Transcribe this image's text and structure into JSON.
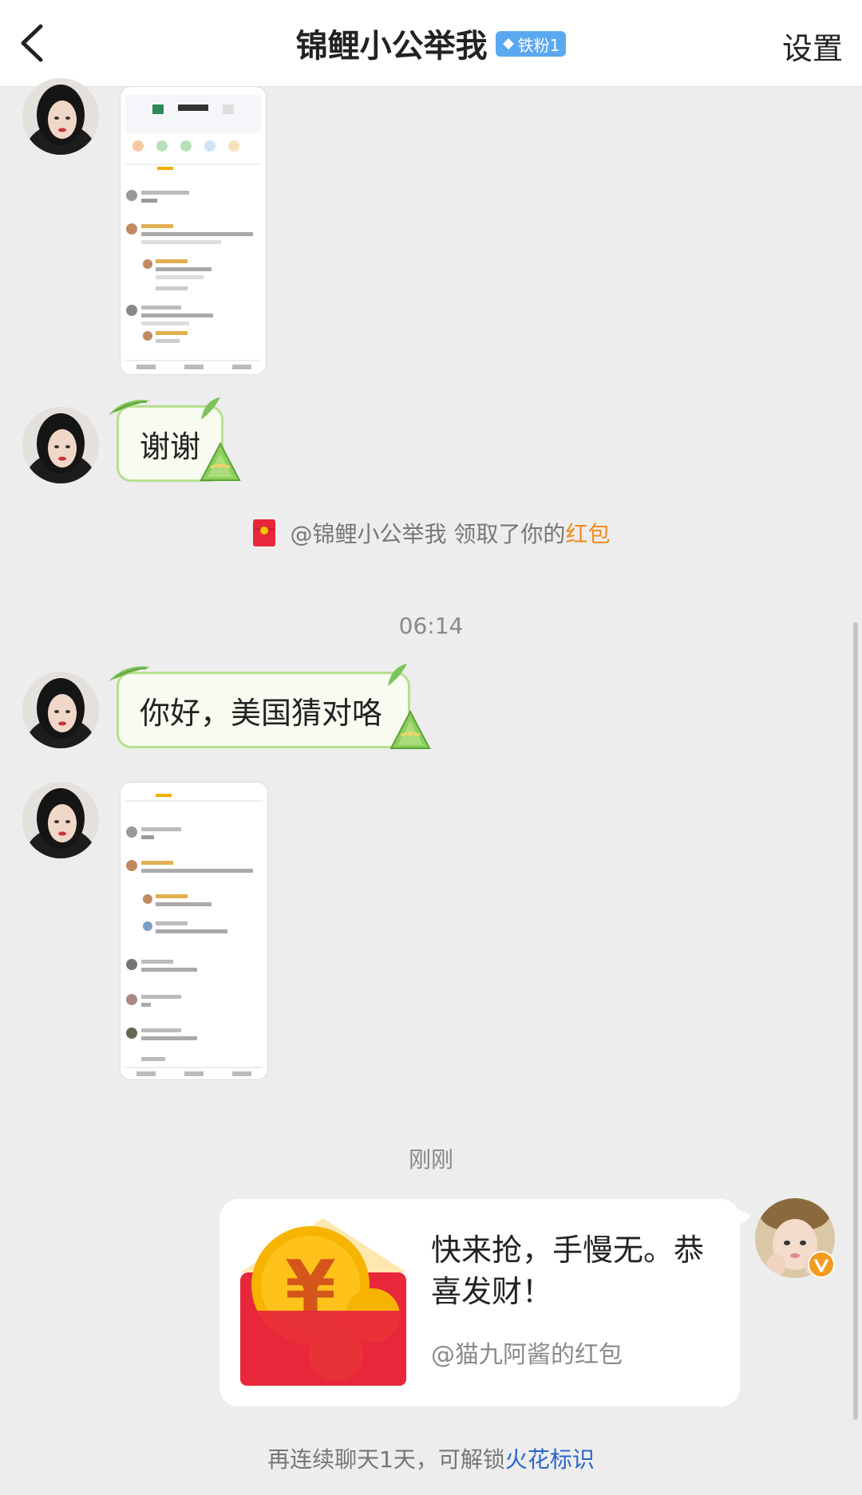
{
  "header": {
    "title": "锦鲤小公举我",
    "fan_badge": "铁粉1",
    "settings_label": "设置",
    "back_icon": "chevron-left-icon"
  },
  "messages": [
    {
      "from": "other",
      "type": "image"
    },
    {
      "from": "other",
      "type": "text",
      "text": "谢谢"
    },
    {
      "type": "system",
      "prefix": "@锦鲤小公举我 领取了你的",
      "highlight": "红包",
      "highlight_color": "#f08a1c"
    },
    {
      "type": "time",
      "text": "06:14"
    },
    {
      "from": "other",
      "type": "text",
      "text": "你好，美国猜对咯"
    },
    {
      "from": "other",
      "type": "image"
    },
    {
      "type": "time",
      "text": "刚刚"
    },
    {
      "from": "me",
      "type": "red_packet",
      "text": "快来抢，手慢无。恭喜发财！",
      "sub": "@猫九阿酱的红包"
    }
  ],
  "footer": {
    "tip_prefix": "再连续聊天1天，可解锁",
    "tip_link": "火花标识",
    "link_color": "#2a66c9"
  },
  "colors": {
    "bubble_bg": "#f7fbf0",
    "bubble_border": "#b8df8e",
    "red_packet": "#e8283a",
    "coin": "#f6b400"
  }
}
